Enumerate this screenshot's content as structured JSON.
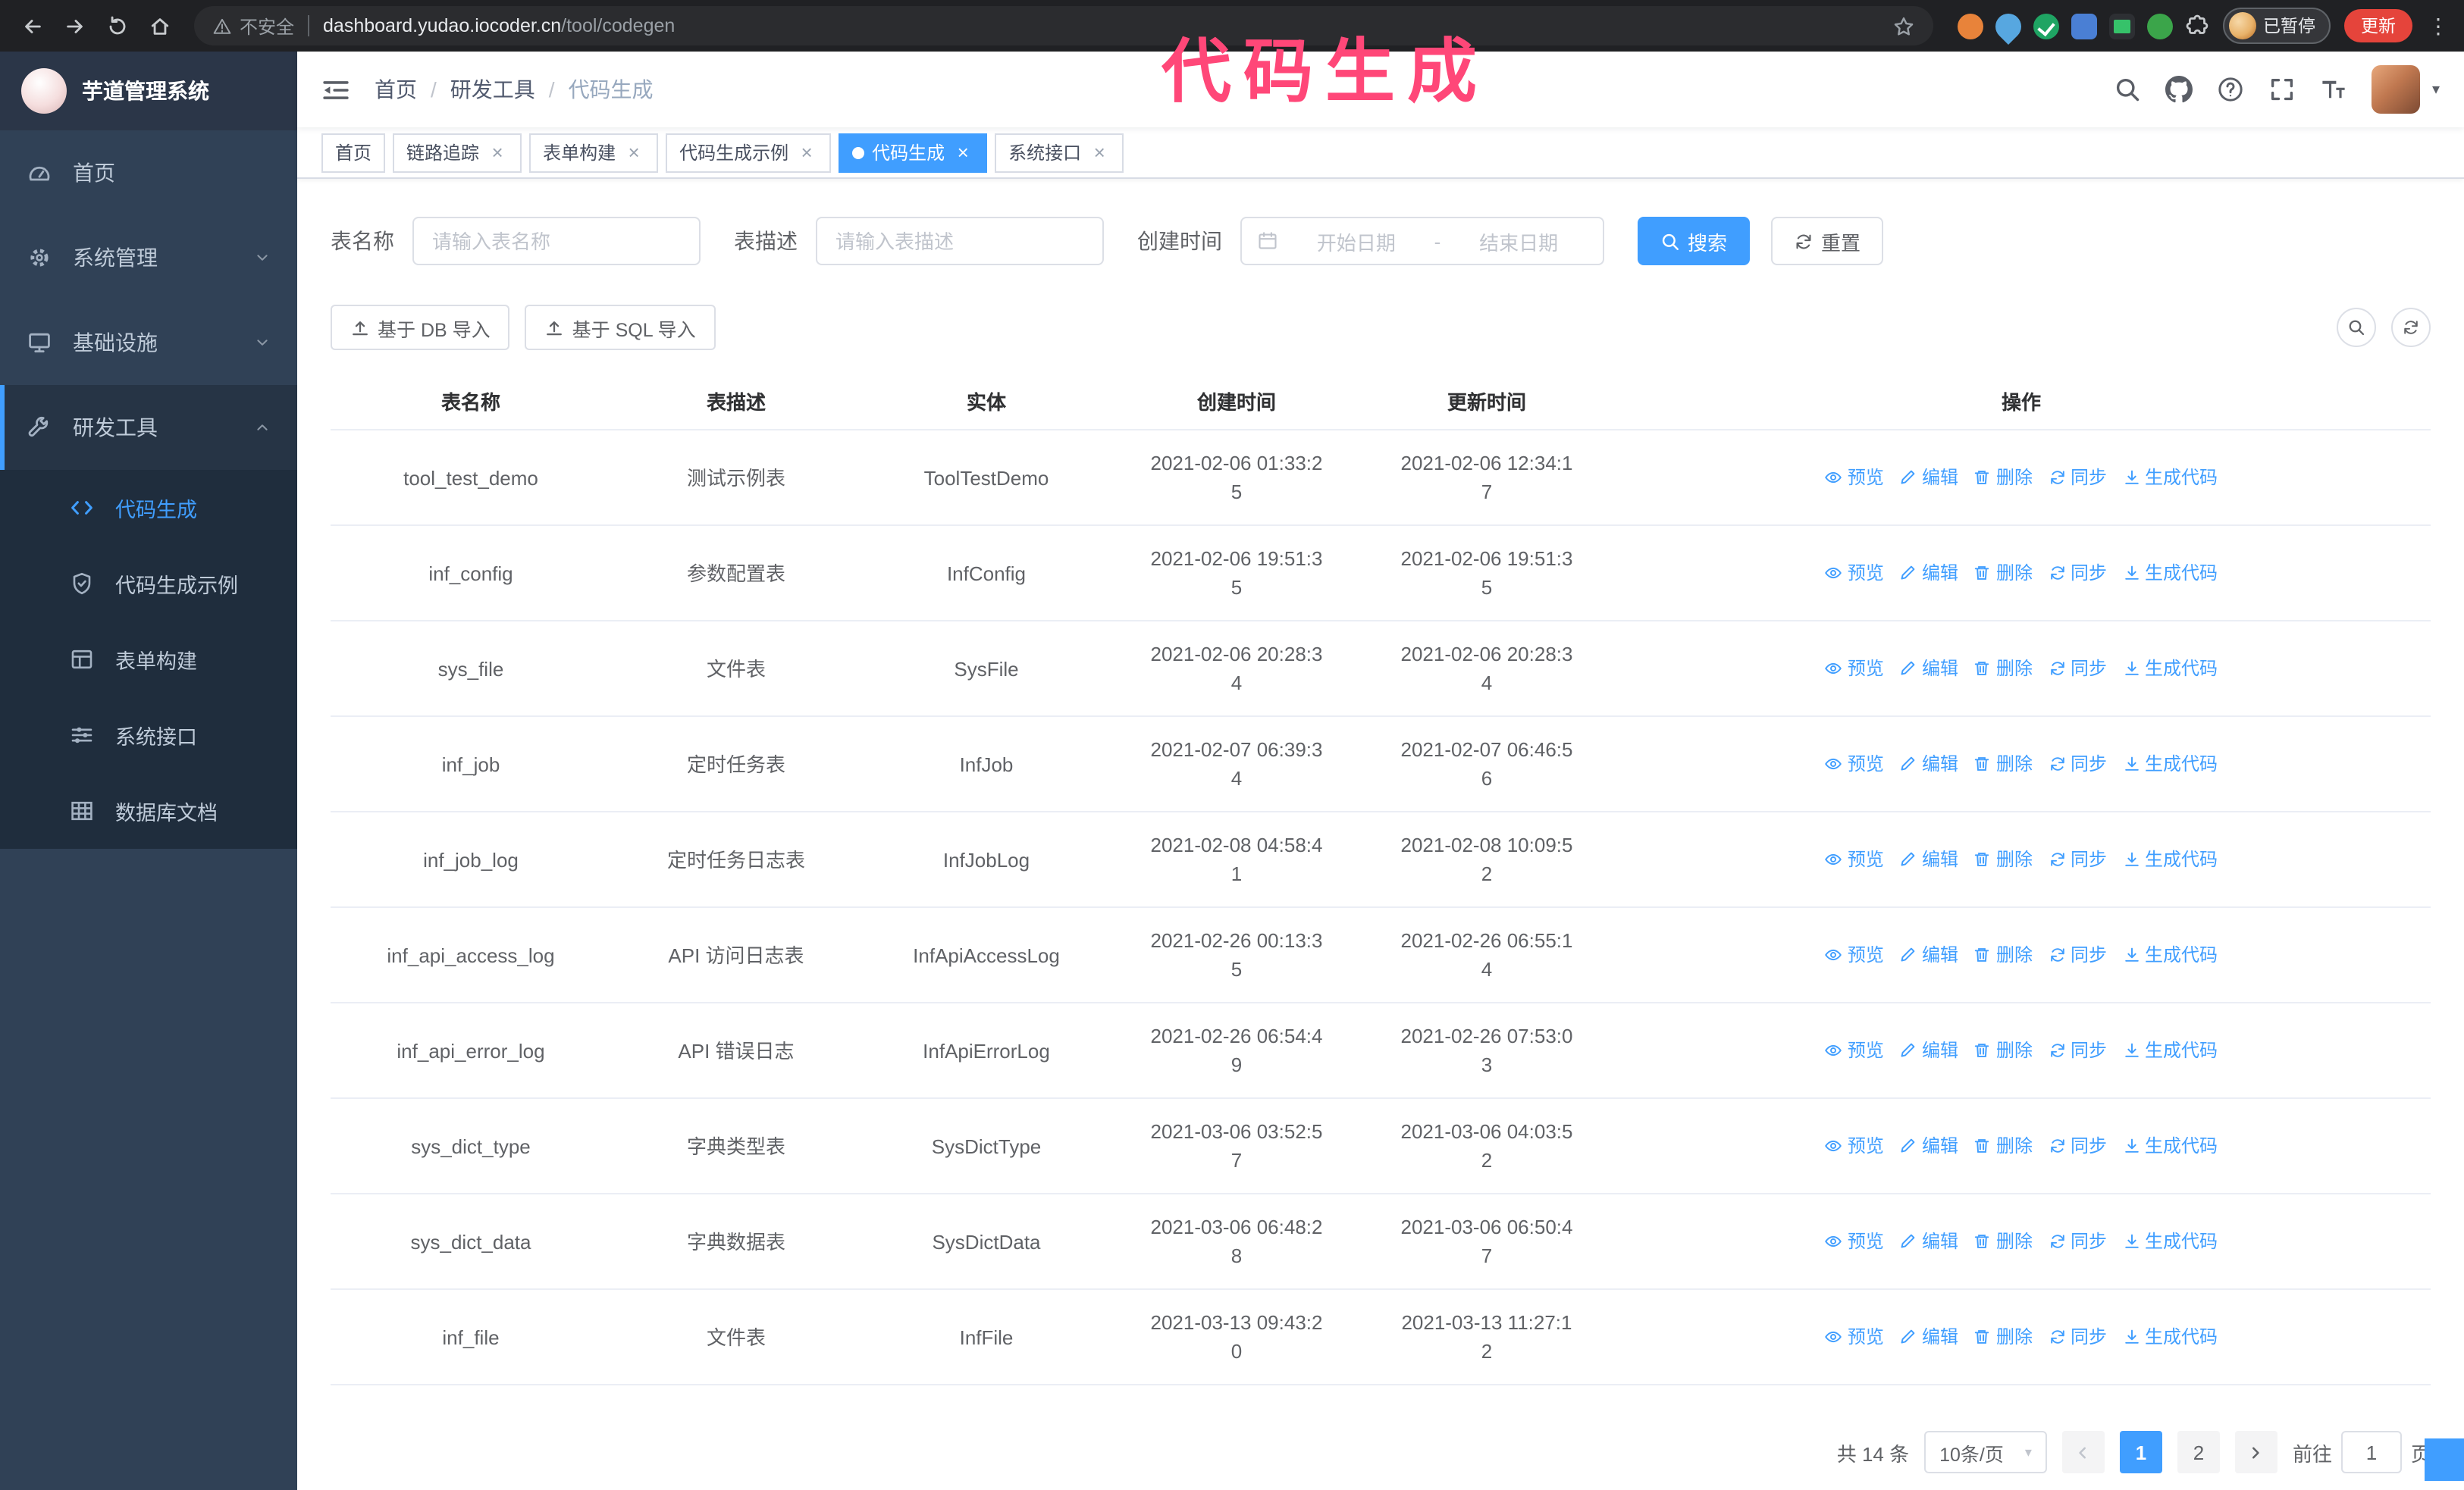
{
  "colors": {
    "primary": "#409eff",
    "sidebar_bg": "#304156",
    "submenu_bg": "#1f2d3d",
    "annotation": "#ff4778",
    "update_button": "#e5443b"
  },
  "annotation": {
    "text": "代码生成"
  },
  "browser": {
    "security_label": "不安全",
    "url_host": "dashboard.yudao.iocoder.cn",
    "url_path": "/tool/codegen",
    "profile_badge": "已暂停",
    "update_button": "更新"
  },
  "sidebar": {
    "logo_title": "芋道管理系统",
    "items": [
      {
        "label": "首页",
        "icon": "home",
        "type": "item"
      },
      {
        "label": "系统管理",
        "icon": "gear",
        "type": "group",
        "state": "collapsed"
      },
      {
        "label": "基础设施",
        "icon": "infra",
        "type": "group",
        "state": "collapsed"
      },
      {
        "label": "研发工具",
        "icon": "tools",
        "type": "group",
        "state": "expanded",
        "active": true
      }
    ],
    "subitems": [
      {
        "label": "代码生成",
        "icon": "code",
        "active": true
      },
      {
        "label": "代码生成示例",
        "icon": "example"
      },
      {
        "label": "表单构建",
        "icon": "form"
      },
      {
        "label": "系统接口",
        "icon": "api"
      },
      {
        "label": "数据库文档",
        "icon": "db-doc"
      }
    ]
  },
  "navbar": {
    "breadcrumb": [
      "首页",
      "研发工具",
      "代码生成"
    ],
    "separator": "/"
  },
  "tags": [
    {
      "label": "首页",
      "closable": false,
      "active": false
    },
    {
      "label": "链路追踪",
      "closable": true,
      "active": false
    },
    {
      "label": "表单构建",
      "closable": true,
      "active": false
    },
    {
      "label": "代码生成示例",
      "closable": true,
      "active": false
    },
    {
      "label": "代码生成",
      "closable": true,
      "active": true
    },
    {
      "label": "系统接口",
      "closable": true,
      "active": false
    }
  ],
  "filters": {
    "table_name_label": "表名称",
    "table_name_placeholder": "请输入表名称",
    "table_desc_label": "表描述",
    "table_desc_placeholder": "请输入表描述",
    "create_time_label": "创建时间",
    "date_start_placeholder": "开始日期",
    "date_separator": "-",
    "date_end_placeholder": "结束日期",
    "search_button": "搜索",
    "reset_button": "重置"
  },
  "toolbar": {
    "import_db_button": "基于 DB 导入",
    "import_sql_button": "基于 SQL 导入"
  },
  "table": {
    "columns": [
      "表名称",
      "表描述",
      "实体",
      "创建时间",
      "更新时间",
      "操作"
    ],
    "actions": [
      {
        "label": "预览",
        "key": "preview",
        "icon": "eye"
      },
      {
        "label": "编辑",
        "key": "edit",
        "icon": "edit"
      },
      {
        "label": "删除",
        "key": "delete",
        "icon": "delete"
      },
      {
        "label": "同步",
        "key": "sync",
        "icon": "sync"
      },
      {
        "label": "生成代码",
        "key": "generate",
        "icon": "download"
      }
    ],
    "rows": [
      {
        "name": "tool_test_demo",
        "desc": "测试示例表",
        "entity": "ToolTestDemo",
        "created": "2021-02-06 01:33:25",
        "updated": "2021-02-06 12:34:17"
      },
      {
        "name": "inf_config",
        "desc": "参数配置表",
        "entity": "InfConfig",
        "created": "2021-02-06 19:51:35",
        "updated": "2021-02-06 19:51:35"
      },
      {
        "name": "sys_file",
        "desc": "文件表",
        "entity": "SysFile",
        "created": "2021-02-06 20:28:34",
        "updated": "2021-02-06 20:28:34"
      },
      {
        "name": "inf_job",
        "desc": "定时任务表",
        "entity": "InfJob",
        "created": "2021-02-07 06:39:34",
        "updated": "2021-02-07 06:46:56"
      },
      {
        "name": "inf_job_log",
        "desc": "定时任务日志表",
        "entity": "InfJobLog",
        "created": "2021-02-08 04:58:41",
        "updated": "2021-02-08 10:09:52"
      },
      {
        "name": "inf_api_access_log",
        "desc": "API 访问日志表",
        "entity": "InfApiAccessLog",
        "created": "2021-02-26 00:13:35",
        "updated": "2021-02-26 06:55:14"
      },
      {
        "name": "inf_api_error_log",
        "desc": "API 错误日志",
        "entity": "InfApiErrorLog",
        "created": "2021-02-26 06:54:49",
        "updated": "2021-02-26 07:53:03"
      },
      {
        "name": "sys_dict_type",
        "desc": "字典类型表",
        "entity": "SysDictType",
        "created": "2021-03-06 03:52:57",
        "updated": "2021-03-06 04:03:52"
      },
      {
        "name": "sys_dict_data",
        "desc": "字典数据表",
        "entity": "SysDictData",
        "created": "2021-03-06 06:48:28",
        "updated": "2021-03-06 06:50:47"
      },
      {
        "name": "inf_file",
        "desc": "文件表",
        "entity": "InfFile",
        "created": "2021-03-13 09:43:20",
        "updated": "2021-03-13 11:27:12"
      }
    ]
  },
  "pagination": {
    "total_text": "共 14 条",
    "page_size": "10条/页",
    "pages": [
      "1",
      "2"
    ],
    "active_page": "1",
    "goto_label": "前往",
    "goto_value": "1",
    "goto_suffix": "页"
  }
}
